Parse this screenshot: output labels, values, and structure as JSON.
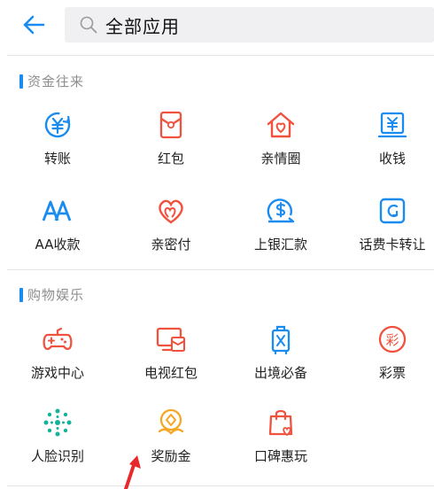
{
  "header": {
    "back_icon": "arrow-left-icon",
    "search_icon": "search-icon",
    "search_text": "全部应用",
    "accent_color": "#1a8cf0"
  },
  "sections": [
    {
      "title": "资金往来",
      "items": [
        {
          "label": "转账",
          "icon": "transfer-icon",
          "color": "#1a8cf0"
        },
        {
          "label": "红包",
          "icon": "red-packet-icon",
          "color": "#f0523e"
        },
        {
          "label": "亲情圈",
          "icon": "family-home-icon",
          "color": "#f0523e"
        },
        {
          "label": "收钱",
          "icon": "receive-money-icon",
          "color": "#1a8cf0"
        },
        {
          "label": "AA收款",
          "icon": "aa-icon",
          "color": "#1a8cf0"
        },
        {
          "label": "亲密付",
          "icon": "double-heart-icon",
          "color": "#f0523e"
        },
        {
          "label": "上银汇款",
          "icon": "dollar-remit-icon",
          "color": "#1a8cf0"
        },
        {
          "label": "话费卡转让",
          "icon": "phone-card-icon",
          "color": "#1a8cf0"
        }
      ]
    },
    {
      "title": "购物娱乐",
      "items": [
        {
          "label": "游戏中心",
          "icon": "gamepad-icon",
          "color": "#f0523e"
        },
        {
          "label": "电视红包",
          "icon": "tv-envelope-icon",
          "color": "#f0523e"
        },
        {
          "label": "出境必备",
          "icon": "luggage-icon",
          "color": "#1a8cf0"
        },
        {
          "label": "彩票",
          "icon": "lottery-icon",
          "color": "#f0523e"
        },
        {
          "label": "人脸识别",
          "icon": "face-dots-icon",
          "color": "#12b39a"
        },
        {
          "label": "奖励金",
          "icon": "reward-coin-icon",
          "color": "#f5a623"
        },
        {
          "label": "口碑惠玩",
          "icon": "shopping-bag-icon",
          "color": "#f0523e"
        }
      ]
    }
  ]
}
